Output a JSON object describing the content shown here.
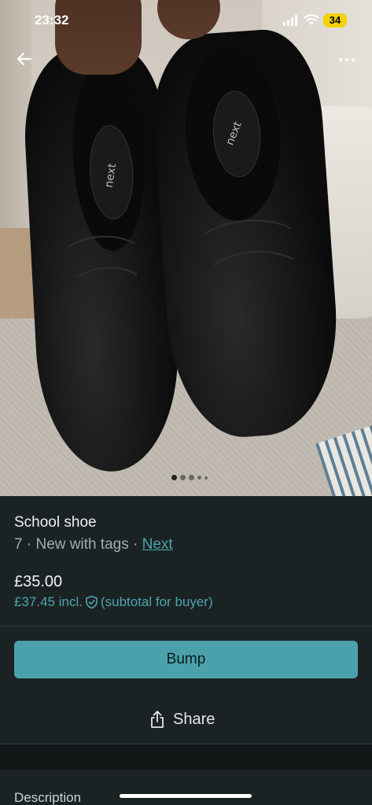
{
  "status_bar": {
    "time": "23:32",
    "battery": "34"
  },
  "photo": {
    "brand_print": "next",
    "pager": {
      "total": 5,
      "active_index": 0
    }
  },
  "listing": {
    "title": "School shoe",
    "size": "7",
    "condition": "New with tags",
    "brand": "Next",
    "price": "£35.00",
    "price_incl": "£37.45 incl.",
    "price_incl_note": "(subtotal for buyer)"
  },
  "actions": {
    "bump_label": "Bump",
    "share_label": "Share"
  },
  "sections": {
    "description_label": "Description"
  },
  "icons": {
    "back": "arrow-left-icon",
    "more": "more-horizontal-icon",
    "shield": "shield-check-icon",
    "share": "share-icon"
  },
  "colors": {
    "background": "#1b2223",
    "accent": "#4aa6b0",
    "button": "#4aa1ab",
    "battery": "#f4d10a"
  }
}
